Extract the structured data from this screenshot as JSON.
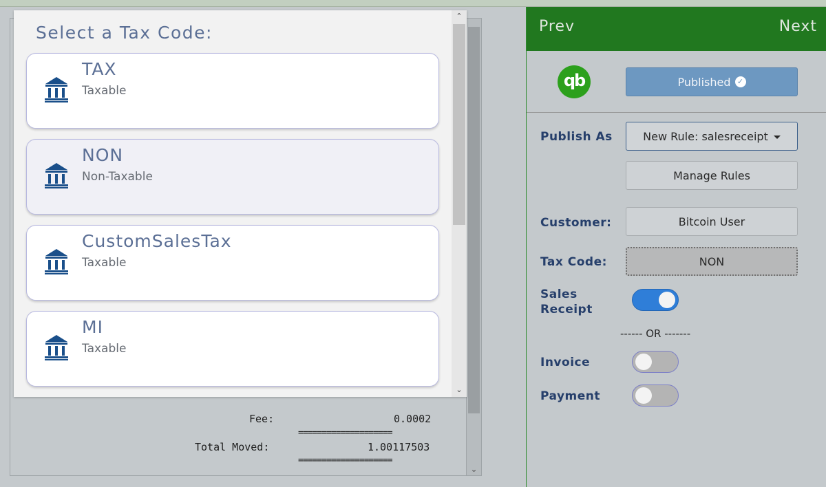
{
  "modal": {
    "title": "Select a Tax Code:",
    "items": [
      {
        "code": "TAX",
        "desc": "Taxable"
      },
      {
        "code": "NON",
        "desc": "Non-Taxable"
      },
      {
        "code": "CustomSalesTax",
        "desc": "Taxable"
      },
      {
        "code": "MI",
        "desc": "Taxable"
      }
    ],
    "selected_index": 1
  },
  "receipt": {
    "fee_label": "Fee:",
    "fee_value": "0.0002",
    "total_label": "Total Moved:",
    "total_value": "1.00117503",
    "eq_line": "===================="
  },
  "nav": {
    "prev": "Prev",
    "next": "Next"
  },
  "qb": {
    "logo_text": "qb",
    "published_label": "Published"
  },
  "form": {
    "publish_as_label": "Publish As",
    "publish_as_value": "New Rule: salesreceipt",
    "manage_rules_label": "Manage Rules",
    "customer_label": "Customer:",
    "customer_value": "Bitcoin User",
    "tax_code_label": "Tax Code:",
    "tax_code_value": "NON",
    "sales_receipt_label_1": "Sales",
    "sales_receipt_label_2": "Receipt",
    "or_text": "------ OR -------",
    "invoice_label": "Invoice",
    "payment_label": "Payment",
    "sales_receipt_on": true,
    "invoice_on": false,
    "payment_on": false
  },
  "colors": {
    "nav_green": "#21781f",
    "qb_green": "#2ca01c",
    "published_blue": "#6d98c1",
    "toggle_on": "#2f7ed8",
    "label_navy": "#263f6b",
    "modal_text": "#5b6f95"
  }
}
